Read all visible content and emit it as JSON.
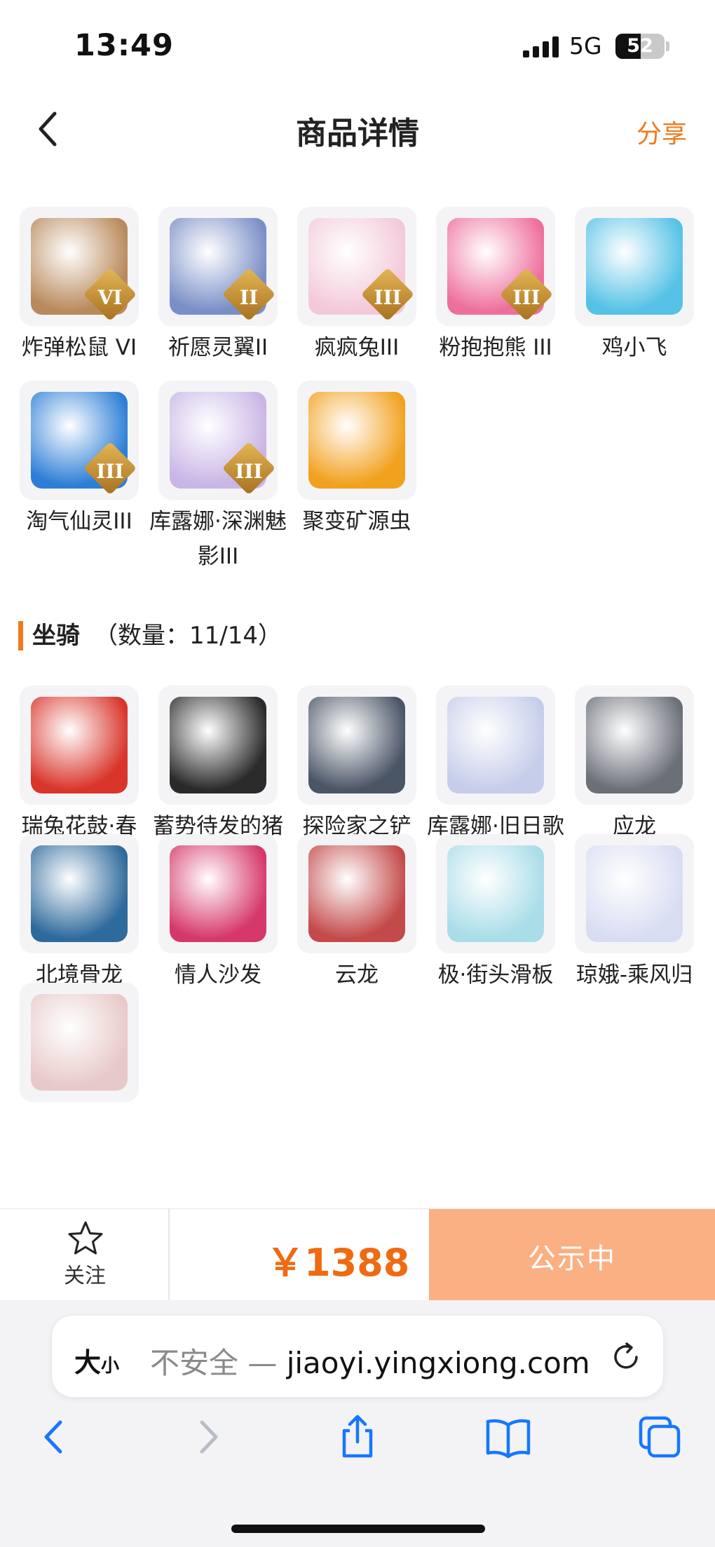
{
  "status_bar": {
    "time": "13:49",
    "network": "5G",
    "battery_level": "52",
    "battery_fraction": 0.52
  },
  "header": {
    "title": "商品详情",
    "share_label": "分享",
    "back_icon": "chevron-left-icon"
  },
  "pets": [
    {
      "name": "炸弹松鼠 VI",
      "grade": "VI",
      "color": "#b98a5c"
    },
    {
      "name": "祈愿灵翼II",
      "grade": "II",
      "color": "#7a8fc7"
    },
    {
      "name": "疯疯兔III",
      "grade": "III",
      "color": "#f3c9d9"
    },
    {
      "name": "粉抱抱熊 III",
      "grade": "III",
      "color": "#ee6f9c"
    },
    {
      "name": "鸡小飞",
      "grade": "",
      "color": "#55c2e6"
    },
    {
      "name": "淘气仙灵III",
      "grade": "III",
      "color": "#2d7fd6"
    },
    {
      "name": "库露娜·深渊魅影III",
      "grade": "III",
      "color": "#c9b6e6"
    },
    {
      "name": "聚变矿源虫",
      "grade": "",
      "color": "#f2a11e"
    }
  ],
  "mounts_section": {
    "title": "坐骑",
    "count": "（数量：11/14）"
  },
  "mounts": [
    {
      "name": "瑞兔花鼓·春",
      "color": "#d9352b"
    },
    {
      "name": "蓄势待发的猪猪怪",
      "color": "#2a2a2a"
    },
    {
      "name": "探险家之铲",
      "color": "#4a5566"
    },
    {
      "name": "库露娜·旧日歌姬",
      "color": "#c5cdea"
    },
    {
      "name": "应龙",
      "color": "#6b6f78"
    },
    {
      "name": "北境骨龙",
      "color": "#2e6a9c"
    },
    {
      "name": "情人沙发",
      "color": "#d6386b"
    },
    {
      "name": "云龙",
      "color": "#c44a4a"
    },
    {
      "name": "极·街头滑板",
      "color": "#a9dde8"
    },
    {
      "name": "琼娥-乘风归",
      "color": "#d8ddf2"
    },
    {
      "name": "",
      "color": "#e8c9c9"
    }
  ],
  "action_bar": {
    "follow_label": "关注",
    "price": "￥1388",
    "status_label": "公示中"
  },
  "browser": {
    "text_size_label": "大",
    "text_size_small": "小",
    "insecure_label": "不安全 — ",
    "url": "jiaoyi.yingxiong.com"
  }
}
